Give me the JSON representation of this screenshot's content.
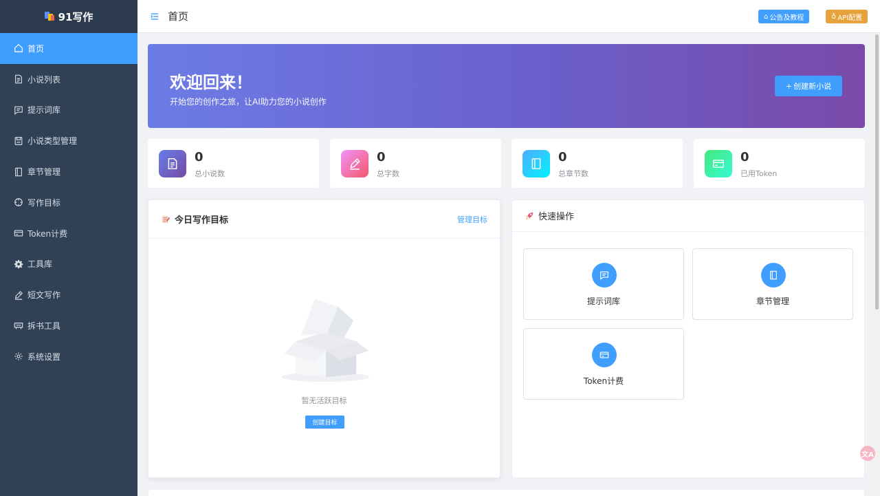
{
  "app": {
    "logo_text": "91写作"
  },
  "sidebar": {
    "items": [
      {
        "label": "首页",
        "icon": "home-icon",
        "active": true
      },
      {
        "label": "小说列表",
        "icon": "document-icon"
      },
      {
        "label": "提示词库",
        "icon": "chat-icon"
      },
      {
        "label": "小说类型管理",
        "icon": "save-icon"
      },
      {
        "label": "章节管理",
        "icon": "notebook-icon"
      },
      {
        "label": "写作目标",
        "icon": "target-icon"
      },
      {
        "label": "Token计费",
        "icon": "credit-card-icon"
      },
      {
        "label": "工具库",
        "icon": "gear-icon"
      },
      {
        "label": "短文写作",
        "icon": "pen-icon"
      },
      {
        "label": "拆书工具",
        "icon": "cart-icon"
      },
      {
        "label": "系统设置",
        "icon": "settings-icon"
      }
    ]
  },
  "header": {
    "title": "首页",
    "notice_button": "公告及教程",
    "api_button": "API配置"
  },
  "banner": {
    "title": "欢迎回来！",
    "subtitle": "开始您的创作之旅，让AI助力您的小说创作",
    "button": "创建新小说"
  },
  "stats": [
    {
      "value": "0",
      "label": "总小说数",
      "icon": "document-icon",
      "color": "#6a67ce"
    },
    {
      "value": "0",
      "label": "总字数",
      "icon": "pen-icon",
      "color": "#f06a9a"
    },
    {
      "value": "0",
      "label": "总章节数",
      "icon": "notebook-icon",
      "color": "#22b8f0"
    },
    {
      "value": "0",
      "label": "已用Token",
      "icon": "credit-card-icon",
      "color": "#2fd39b"
    }
  ],
  "goals": {
    "title": "今日写作目标",
    "manage_link": "管理目标",
    "empty_text": "暂无活跃目标",
    "create_button": "创建目标"
  },
  "quick": {
    "title": "快速操作",
    "items": [
      {
        "label": "提示词库",
        "icon": "chat-icon"
      },
      {
        "label": "章节管理",
        "icon": "notebook-icon"
      },
      {
        "label": "Token计费",
        "icon": "credit-card-icon"
      }
    ]
  },
  "colors": {
    "primary": "#409eff",
    "sidebar": "#304156",
    "warning": "#e6a23c"
  }
}
